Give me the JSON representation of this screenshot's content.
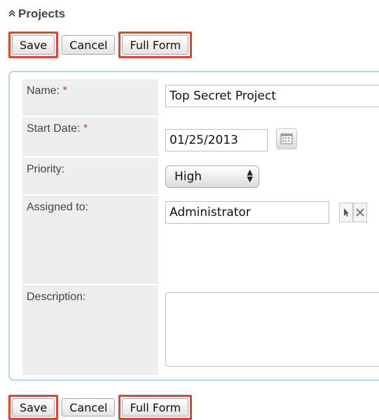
{
  "header": {
    "title": "Projects",
    "collapse_glyph": "≈"
  },
  "toolbar": {
    "save_label": "Save",
    "cancel_label": "Cancel",
    "full_form_label": "Full Form"
  },
  "form": {
    "name": {
      "label": "Name:",
      "required_mark": "*",
      "value": "Top Secret Project"
    },
    "start_date": {
      "label": "Start Date:",
      "required_mark": "*",
      "value": "01/25/2013"
    },
    "priority": {
      "label": "Priority:",
      "selected": "High"
    },
    "assigned_to": {
      "label": "Assigned to:",
      "value": "Administrator"
    },
    "description": {
      "label": "Description:",
      "value": ""
    }
  },
  "icons": {
    "collapse": "double-chevron-up-icon",
    "calendar": "calendar-icon",
    "select": "arrow-cursor-icon",
    "clear": "close-x-icon",
    "dropdown": "up-down-arrows-icon"
  },
  "colors": {
    "highlight": "#e8402a",
    "required": "#e0382a",
    "panel_border": "#b9d4ee",
    "label_bg": "#eeeeee"
  }
}
